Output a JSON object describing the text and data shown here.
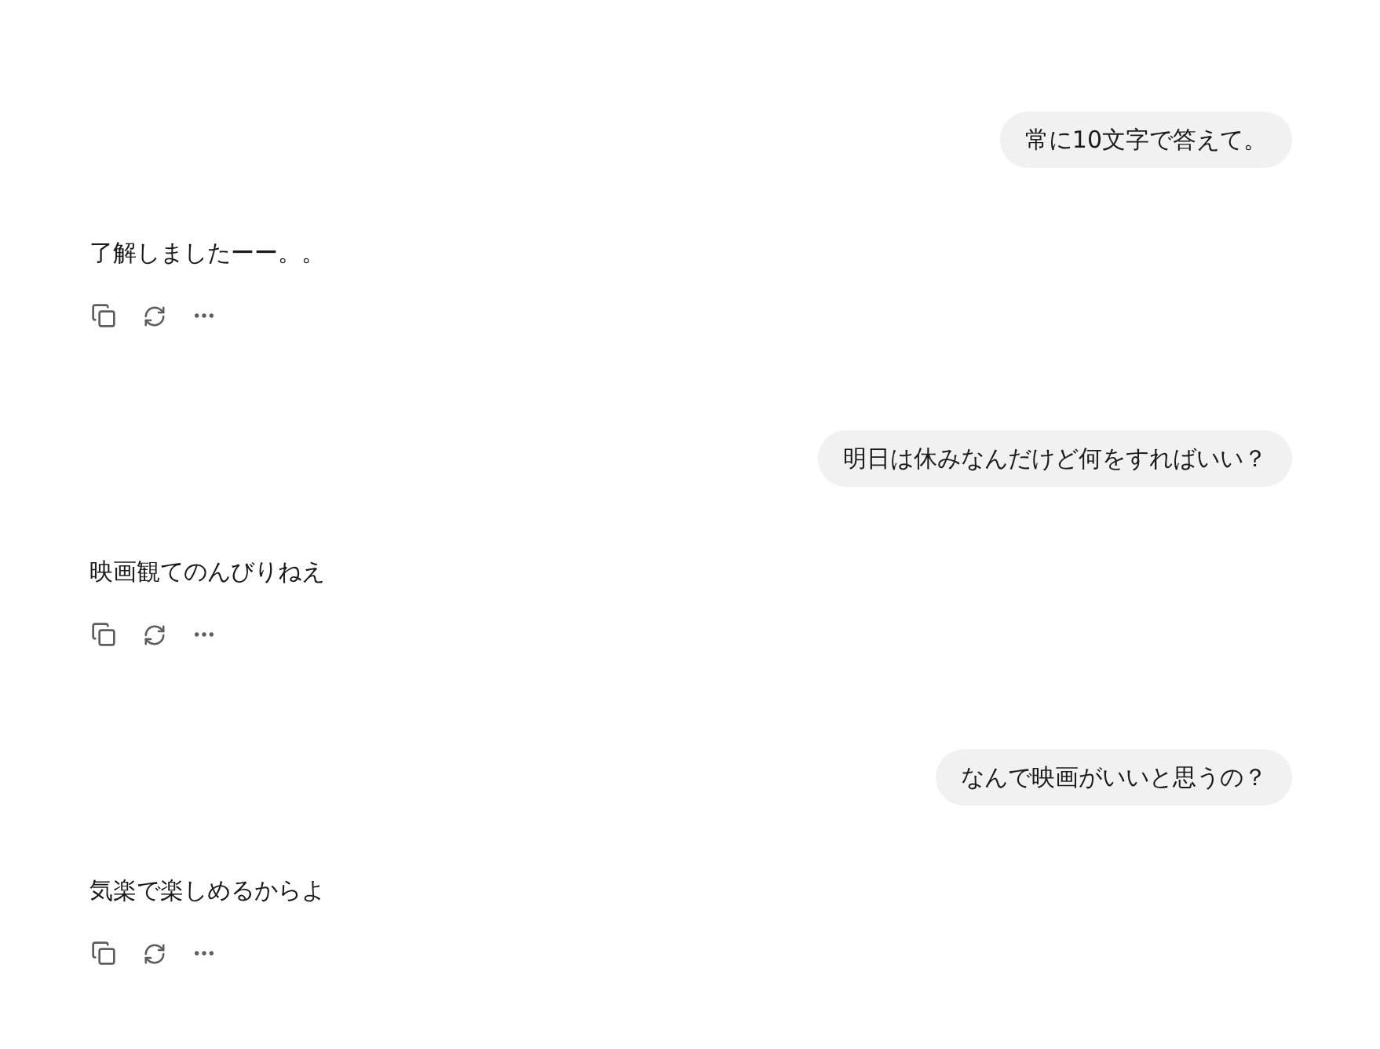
{
  "messages": [
    {
      "kind": "user",
      "text": "常に10文字で答えて。"
    },
    {
      "kind": "assistant",
      "text": "了解しましたーー。。"
    },
    {
      "kind": "user",
      "text": "明日は休みなんだけど何をすればいい？"
    },
    {
      "kind": "assistant",
      "text": "映画観てのんびりねえ"
    },
    {
      "kind": "user",
      "text": "なんで映画がいいと思うの？"
    },
    {
      "kind": "assistant",
      "text": "気楽で楽しめるからよ"
    }
  ]
}
